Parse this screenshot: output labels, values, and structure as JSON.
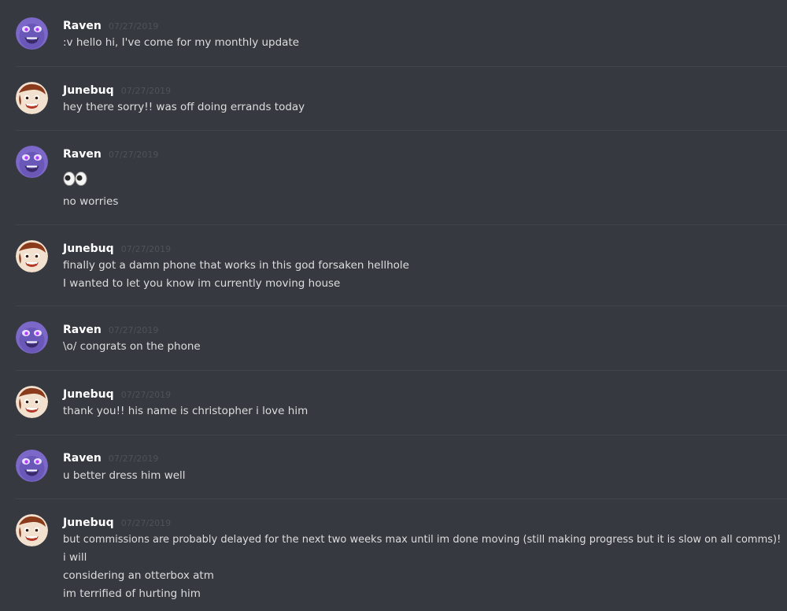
{
  "messages": [
    {
      "author": "Raven",
      "avatar": "raven-avatar",
      "timestamp": "07/27/2019",
      "lines": [
        ":v hello hi, I've come for my monthly update"
      ]
    },
    {
      "author": "Junebuq",
      "avatar": "junebuq-avatar",
      "timestamp": "07/27/2019",
      "lines": [
        "hey there sorry!! was off doing errands today"
      ]
    },
    {
      "author": "Raven",
      "avatar": "raven-avatar",
      "timestamp": "07/27/2019",
      "emoji": "eyes-emoji",
      "lines": [
        "no worries"
      ]
    },
    {
      "author": "Junebuq",
      "avatar": "junebuq-avatar",
      "timestamp": "07/27/2019",
      "lines": [
        "finally got a damn phone that works in this god forsaken hellhole",
        "I wanted to let you know im currently moving house"
      ]
    },
    {
      "author": "Raven",
      "avatar": "raven-avatar",
      "timestamp": "07/27/2019",
      "lines": [
        "\\o/ congrats on the phone"
      ]
    },
    {
      "author": "Junebuq",
      "avatar": "junebuq-avatar",
      "timestamp": "07/27/2019",
      "lines": [
        "thank you!! his name is christopher i love him"
      ]
    },
    {
      "author": "Raven",
      "avatar": "raven-avatar",
      "timestamp": "07/27/2019",
      "lines": [
        "u better dress him well"
      ]
    },
    {
      "author": "Junebuq",
      "avatar": "junebuq-avatar",
      "timestamp": "07/27/2019",
      "lines": [
        "but commissions are probably delayed for the next two weeks max until im done moving (still making progress but it is slow on all comms)!",
        "i will",
        "considering an otterbox atm",
        "im terrified of hurting him"
      ]
    }
  ],
  "colors": {
    "background": "#36393f",
    "author": "#ffffff",
    "timestamp": "#4f5258",
    "text": "#dcddde",
    "divider": "#40444b"
  }
}
